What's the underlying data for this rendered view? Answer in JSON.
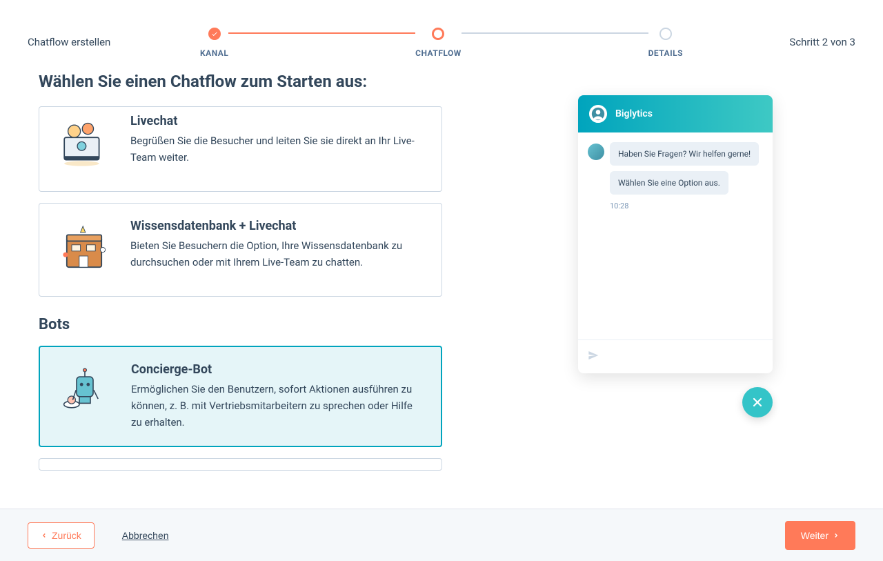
{
  "header": {
    "title": "Chatflow erstellen",
    "step_indicator": "Schritt 2 von 3",
    "steps": [
      {
        "label": "KANAL",
        "state": "done"
      },
      {
        "label": "CHATFLOW",
        "state": "active"
      },
      {
        "label": "DETAILS",
        "state": "pending"
      }
    ]
  },
  "page_title": "Wählen Sie einen Chatflow zum Starten aus:",
  "sections": {
    "bots_heading": "Bots"
  },
  "cards": {
    "livechat": {
      "title": "Livechat",
      "desc": "Begrüßen Sie die Besucher und leiten Sie sie direkt an Ihr Live-Team weiter."
    },
    "kb_livechat": {
      "title": "Wissensdatenbank + Livechat",
      "desc": "Bieten Sie Besuchern die Option, Ihre Wissensdatenbank zu durchsuchen oder mit Ihrem Live-Team zu chatten."
    },
    "concierge": {
      "title": "Concierge-Bot",
      "desc": "Ermöglichen Sie den Benutzern, sofort Aktionen ausführen zu können, z. B. mit Vertriebsmitarbeitern zu sprechen oder Hilfe zu erhalten."
    }
  },
  "preview": {
    "company": "Biglytics",
    "messages": [
      "Haben Sie Fragen? Wir helfen gerne!",
      "Wählen Sie eine Option aus."
    ],
    "timestamp": "10:28"
  },
  "footer": {
    "back": "Zurück",
    "cancel": "Abbrechen",
    "next": "Weiter"
  }
}
